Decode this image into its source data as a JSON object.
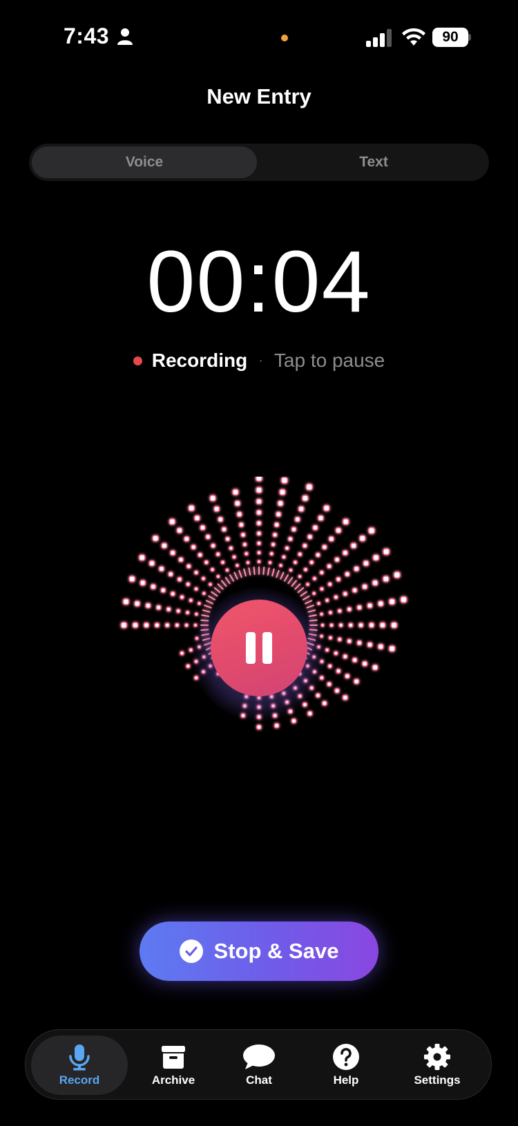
{
  "status_bar": {
    "time": "7:43",
    "battery": "90"
  },
  "header": {
    "title": "New Entry"
  },
  "mode_switch": {
    "options": [
      "Voice",
      "Text"
    ],
    "selected": "Voice"
  },
  "recorder": {
    "timer": "00:04",
    "state_label": "Recording",
    "separator": "·",
    "hint": "Tap to pause"
  },
  "actions": {
    "stop_save_label": "Stop & Save"
  },
  "tab_bar": {
    "items": [
      {
        "label": "Record",
        "icon": "microphone-icon",
        "active": true
      },
      {
        "label": "Archive",
        "icon": "archive-box-icon",
        "active": false
      },
      {
        "label": "Chat",
        "icon": "chat-bubble-icon",
        "active": false
      },
      {
        "label": "Help",
        "icon": "question-circle-icon",
        "active": false
      },
      {
        "label": "Settings",
        "icon": "gear-icon",
        "active": false
      }
    ]
  },
  "colors": {
    "recording_dot": "#e5484d",
    "active_tab": "#5aa6f2",
    "stop_button_start": "#5d7bf2",
    "stop_button_end": "#8a47e0",
    "pause_button": "#e14a6d"
  }
}
